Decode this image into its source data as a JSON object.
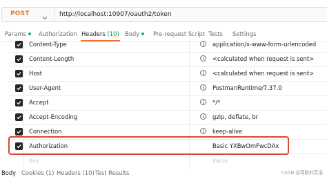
{
  "request": {
    "method": "POST",
    "url": "http://localhost:10907/oauth2/token"
  },
  "tabs": [
    {
      "label": "Params",
      "dot": true
    },
    {
      "label": "Authorization"
    },
    {
      "label": "Headers",
      "count": "(10)",
      "active": true
    },
    {
      "label": "Body",
      "dot": true
    },
    {
      "label": "Pre-request Script"
    },
    {
      "label": "Tests"
    },
    {
      "label": "Settings"
    }
  ],
  "headers": [
    {
      "key": "Content-Type",
      "value": "application/x-www-form-urlencoded",
      "checked": true
    },
    {
      "key": "Content-Length",
      "value": "<calculated when request is sent>",
      "checked": true
    },
    {
      "key": "Host",
      "value": "<calculated when request is sent>",
      "checked": true
    },
    {
      "key": "User-Agent",
      "value": "PostmanRuntime/7.37.0",
      "checked": true
    },
    {
      "key": "Accept",
      "value": "*/*",
      "checked": true
    },
    {
      "key": "Accept-Encoding",
      "value": "gzip, deflate, br",
      "checked": true
    },
    {
      "key": "Connection",
      "value": "keep-alive",
      "checked": true
    },
    {
      "key": "Authorization",
      "value": "Basic YXBwOmFwcDAx",
      "checked": true,
      "highlighted": true
    }
  ],
  "placeholder": {
    "key": "Key",
    "value": "Value"
  },
  "response_tabs": [
    {
      "label": "Body",
      "active": true
    },
    {
      "label": "Cookies",
      "count": "(1)"
    },
    {
      "label": "Headers",
      "count": "(10)"
    },
    {
      "label": "Test Results"
    }
  ],
  "watermark": "CSDN @莓酥的芙语",
  "colors": {
    "method": "#e6772b",
    "active_tab_underline": "#ff6c37",
    "count": "#0c8f3b",
    "status_dot": "#0cbb52",
    "highlight_border": "#d64834",
    "checkbox": "#262626"
  },
  "icons": {
    "method_dropdown": "chevron-down-icon",
    "checkbox": "checkmark-icon",
    "info": "info-icon"
  }
}
